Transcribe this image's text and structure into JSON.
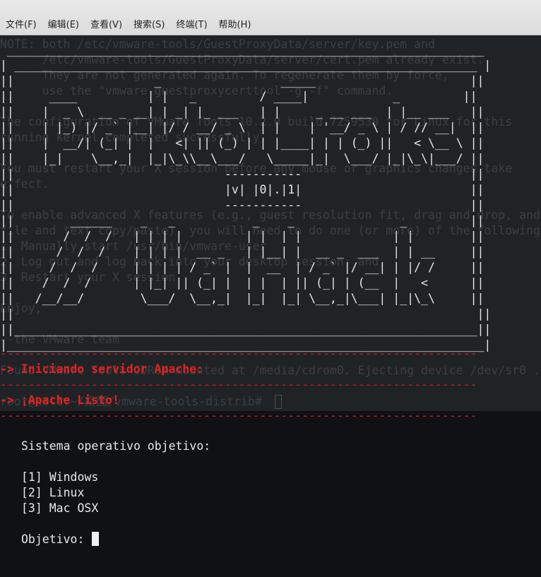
{
  "menubar": {
    "items": [
      "文件(F)",
      "编辑(E)",
      "查看(V)",
      "搜索(S)",
      "终端(T)",
      "帮助(H)"
    ]
  },
  "background_text": {
    "lines": [
      "NOTE: both /etc/vmware-tools/GuestProxyData/server/key.pem and",
      "      /etc/vmware-tools/GuestProxyData/server/cert.pem already exist.",
      "      They are not generated again. To regenerate them by force,",
      "      use the \"vmware-guestproxycerttool -g -f\" command.",
      "",
      "The configuration of VMware Tools 10.2.0 build-7259539 for Linux for this",
      "running kernel completed successfully.",
      "",
      "You must restart your X session before any mouse or graphics changes take",
      "effect.",
      "",
      "To enable advanced X features (e.g., guest resolution fit, drag and drop, and",
      "file and text copy/paste), you will need to do one (or more) of the following:",
      "1. Manually start /usr/bin/vmware-user",
      "2. Log out and log back into your desktop session; and,",
      "3. Restart your X session.",
      "",
      "Enjoy,",
      "",
      "--the VMware team",
      "",
      "Found VMware Tools CDROM mounted at /media/cdrom0. Ejecting device /dev/sr0 ...",
      "",
      "root@kali:~/桌面/vmware-tools-distrib#"
    ]
  },
  "banner": {
    "ascii": " ____________________________________________________________________\n| __________________________________________________________________ |\n||                    _                 _____                      ||\n||     ____          | |   _         / ____|            _         ||\n||    |  _ \\  __ _ __| | _| |_ ___   | |     _ __ ___  | |__ ___   ||\n||    | |_) |/ _` |__| |/ / __/ _ \\  | |    | '__/ _ \\ | / // __|  ||\n||    |  __/| (_| |  |   <| || (_) | | |____| | | (_) ||   < \\__ \\ ||\n||    |_|    \\__,_|  |_|\\_\\\\__\\___/   \\_____|_|  \\___/ |_|\\_\\|___/ ||\n||                              -----------                        ||\n||                              |v| |0|.|1|                        ||\n||                              -----------                        ||\n||        ______    _   _           _    _               _         ||\n||       /  /  /   | | | |         | |  | |             | |        ||\n||      /  /  /    | | | |  __ _   | |__| |  __ _  ___  | | __     ||\n||     /  /  /     | | | | / _` |  |  __  | / _` |/ __| | |/ /     ||\n||    /  /  /      | |_| || (_| |  | |  | || (_| | (__  |   <      ||\n||   /__/__/        \\___/  \\__,_|  |_|  |_| \\__,_|\\___| |_|\\_\\     ||\n||                                                                  ||\n||__________________________________________________________________||\n|____________________________________________________________________|",
    "version": "|v| |0|.|1|"
  },
  "messages": {
    "separator": "--------------------------------------------------------------------",
    "starting": "-> Iniciando servidor Apache:",
    "ready": "-> ¡Apache Listo!"
  },
  "menu": {
    "title": "Sistema operativo objetivo:",
    "options": [
      "[1] Windows",
      "[2] Linux",
      "[3] Mac OSX"
    ],
    "prompt_label": "Objetivo:",
    "prompt_value": ""
  }
}
